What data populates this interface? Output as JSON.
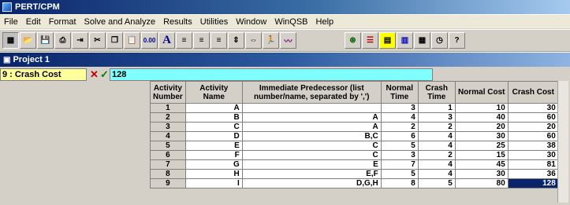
{
  "app": {
    "title": "PERT/CPM"
  },
  "menu": [
    "File",
    "Edit",
    "Format",
    "Solve and Analyze",
    "Results",
    "Utilities",
    "Window",
    "WinQSB",
    "Help"
  ],
  "toolbar": {
    "left_icons": [
      "grid-icon",
      "open-folder-icon",
      "save-icon",
      "print-icon",
      "move-icon",
      "cut-icon",
      "copy-icon",
      "paste-icon",
      "number-format-icon",
      "font-icon",
      "align-left-icon",
      "align-center-icon",
      "align-right-icon",
      "row-height-icon",
      "column-width-icon",
      "solve-icon",
      "chart-icon"
    ],
    "decimal_label": "0.00",
    "font_label": "A",
    "right_icons": [
      "network-icon",
      "gantt-icon",
      "table-view-icon",
      "bar-chart-icon",
      "calendar-icon",
      "clock-icon",
      "help-icon"
    ]
  },
  "window": {
    "title": "Project 1"
  },
  "entry": {
    "cell_ref": "9 : Crash Cost",
    "value": "128"
  },
  "table": {
    "headers": [
      "Activity Number",
      "Activity Name",
      "Immediate Predecessor (list number/name, separated by ',')",
      "Normal Time",
      "Crash Time",
      "Normal Cost",
      "Crash Cost"
    ],
    "rows": [
      [
        "1",
        "A",
        "",
        "3",
        "1",
        "10",
        "30"
      ],
      [
        "2",
        "B",
        "A",
        "4",
        "3",
        "40",
        "60"
      ],
      [
        "3",
        "C",
        "A",
        "2",
        "2",
        "20",
        "20"
      ],
      [
        "4",
        "D",
        "B,C",
        "6",
        "4",
        "30",
        "60"
      ],
      [
        "5",
        "E",
        "C",
        "5",
        "4",
        "25",
        "38"
      ],
      [
        "6",
        "F",
        "C",
        "3",
        "2",
        "15",
        "30"
      ],
      [
        "7",
        "G",
        "E",
        "7",
        "4",
        "45",
        "81"
      ],
      [
        "8",
        "H",
        "E,F",
        "5",
        "4",
        "30",
        "36"
      ],
      [
        "9",
        "I",
        "D,G,H",
        "8",
        "5",
        "80",
        "128"
      ]
    ]
  },
  "colors": {
    "title_bar": "#0a246a",
    "cell_ref_bg": "#ffff9c",
    "edit_bg": "#7fffff",
    "selected_cell": "#0a246a"
  }
}
